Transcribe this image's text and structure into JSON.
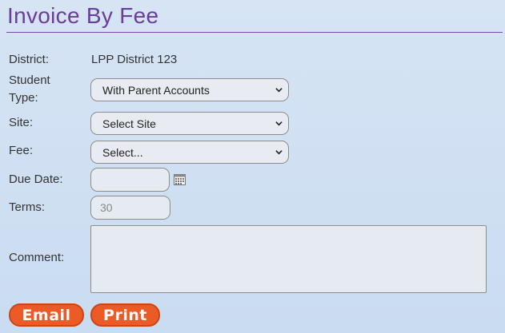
{
  "page": {
    "title": "Invoice By Fee"
  },
  "form": {
    "district": {
      "label": "District:",
      "value": "LPP District 123"
    },
    "student_type": {
      "label_line1": "Student",
      "label_line2": "Type:",
      "selected": "With Parent Accounts"
    },
    "site": {
      "label": "Site:",
      "selected": "Select Site"
    },
    "fee": {
      "label": "Fee:",
      "selected": "Select..."
    },
    "due_date": {
      "label": "Due Date:",
      "value": ""
    },
    "terms": {
      "label": "Terms:",
      "value": "30"
    },
    "comment": {
      "label": "Comment:",
      "value": ""
    }
  },
  "buttons": {
    "email": "Email",
    "print": "Print"
  },
  "icons": {
    "calendar": "calendar-icon",
    "dropdown": "chevron-down-icon"
  },
  "colors": {
    "title": "#6a3d9a",
    "button": "#ec5b26",
    "background": "#d6e4f4"
  }
}
